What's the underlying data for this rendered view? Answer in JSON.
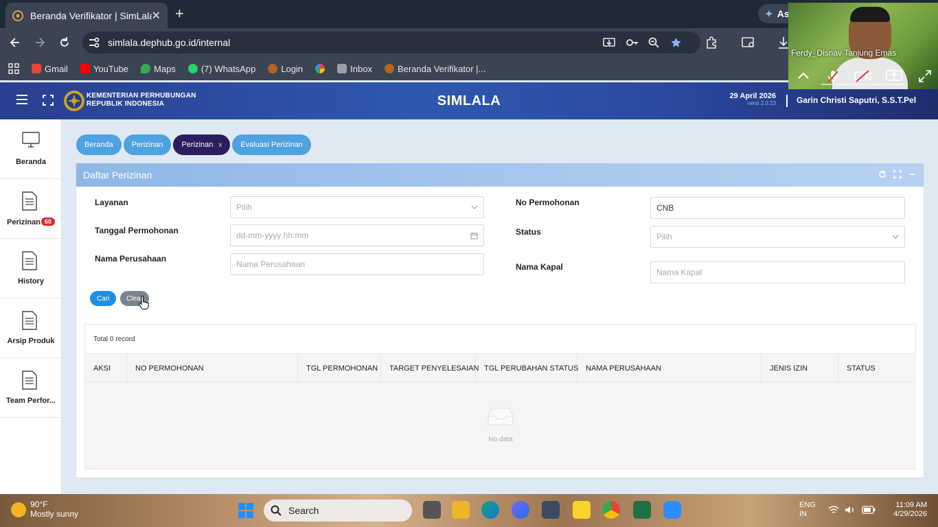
{
  "browser": {
    "tab_title": "Beranda Verifikator | SimLala",
    "tab_close": "✕",
    "new_tab": "+",
    "url": "simlala.dephub.go.id/internal",
    "assistant_chip": "As",
    "bookmarks": [
      {
        "label": "Gmail",
        "color": "#ea4335"
      },
      {
        "label": "YouTube",
        "color": "#ff0000"
      },
      {
        "label": "Maps",
        "color": "#34a853"
      },
      {
        "label": "(7) WhatsApp",
        "color": "#25d366"
      },
      {
        "label": "Login",
        "color": "#b5651d"
      },
      {
        "label": "",
        "color": "#f4b400"
      },
      {
        "label": "Inbox",
        "color": "#9aa0a6"
      },
      {
        "label": "Beranda Verifikator |...",
        "color": "#b5651d"
      }
    ]
  },
  "video_call": {
    "participant_name": "Ferdy_Disnav Tanjung Emas"
  },
  "header": {
    "ministry_line1": "KEMENTERIAN PERHUBUNGAN",
    "ministry_line2": "REPUBLIK INDONESIA",
    "app_name": "SIMLALA",
    "date": "29 April 2026",
    "version": "versi 2.0.23",
    "user": "Garin Christi Saputri, S.S.T.Pel"
  },
  "sidebar": {
    "items": [
      {
        "label": "Beranda",
        "icon": "monitor-icon"
      },
      {
        "label": "Perizinan",
        "icon": "document-icon",
        "badge": "60"
      },
      {
        "label": "History",
        "icon": "document-icon"
      },
      {
        "label": "Arsip Produk",
        "icon": "document-icon"
      },
      {
        "label": "Team Perfor...",
        "icon": "document-icon"
      }
    ]
  },
  "breadcrumbs": [
    {
      "label": "Beranda",
      "active": false
    },
    {
      "label": "Perizinan",
      "active": false
    },
    {
      "label": "Perizinan",
      "active": true,
      "close": "x"
    },
    {
      "label": "Evaluasi Perizinan",
      "active": false
    }
  ],
  "panel": {
    "title": "Daftar Perizinan"
  },
  "form": {
    "layanan_label": "Layanan",
    "layanan_placeholder": "Pilih",
    "tanggal_label": "Tanggal Permohonan",
    "tanggal_placeholder": "dd-mm-yyyy hh:mm",
    "nama_perusahaan_label": "Nama Perusahaan",
    "nama_perusahaan_placeholder": "Nama Perusahaan",
    "no_permohonan_label": "No Permohonan",
    "no_permohonan_value": "CNB",
    "status_label": "Status",
    "status_placeholder": "Pilih",
    "nama_kapal_label": "Nama Kapal",
    "nama_kapal_placeholder": "Nama Kapal",
    "cari_label": "Cari",
    "clear_label": "Clear"
  },
  "table": {
    "total_text": "Total 0 record",
    "columns": [
      "AKSI",
      "NO PERMOHONAN",
      "TGL PERMOHONAN",
      "TARGET PENYELESAIAN",
      "TGL PERUBAHAN STATUS",
      "NAMA PERUSAHAAN",
      "JENIS IZIN",
      "STATUS"
    ],
    "empty_text": "No data"
  },
  "taskbar": {
    "temperature": "90°F",
    "weather": "Mostly sunny",
    "search_label": "Search",
    "lang1": "ENG",
    "lang2": "IN",
    "time": "11:09 AM",
    "date": "4/29/2026"
  }
}
